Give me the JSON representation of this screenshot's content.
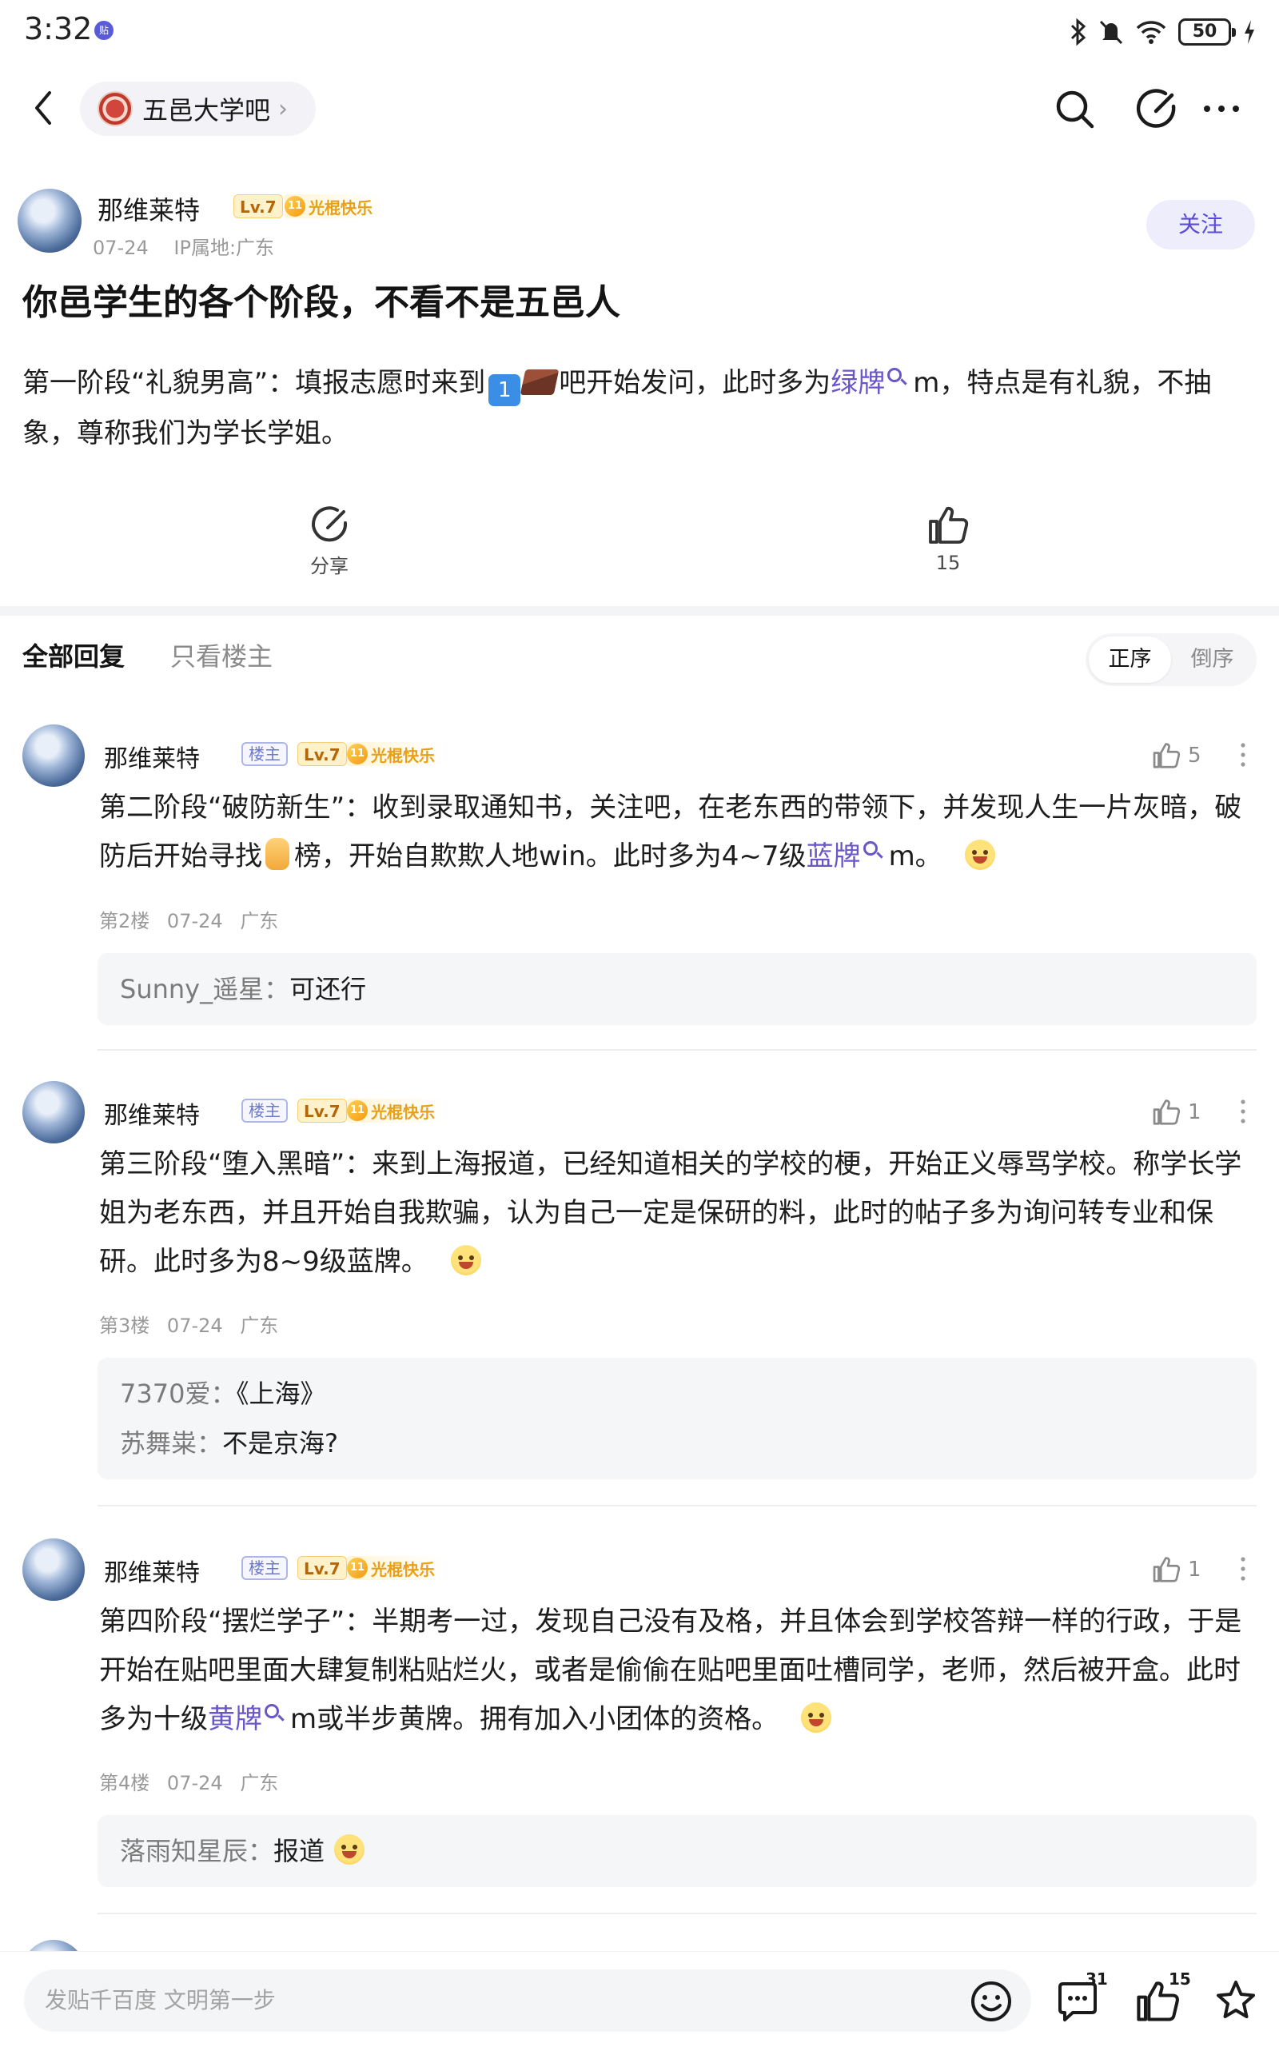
{
  "status_bar": {
    "time": "3:32",
    "battery": "50"
  },
  "nav": {
    "forum_name": "五邑大学吧"
  },
  "post": {
    "author": "那维莱特",
    "level": "Lv.7",
    "member_label": "光棍快乐",
    "member_badge_num": "11",
    "date": "07-24",
    "ip": "IP属地:广东",
    "follow_label": "关注",
    "title": "你邑学生的各个阶段，不看不是五邑人",
    "body_part1": "第一阶段“礼貌男高”：填报志愿时来到",
    "emoji_one": "1",
    "body_part2": "吧开始发问，此时多为",
    "body_link": "绿牌",
    "body_part3": "m，特点是有礼貌，不抽象，尊称我们为学长学姐。",
    "share_label": "分享",
    "like_count": "15"
  },
  "reply_tabs": {
    "all_label": "全部回复",
    "owner_only_label": "只看楼主",
    "sort_asc": "正序",
    "sort_desc": "倒序"
  },
  "replies": [
    {
      "author": "那维莱特",
      "owner_tag": "楼主",
      "level": "Lv.7",
      "member_label": "光棍快乐",
      "likes": "5",
      "text_part1": "第二阶段“破防新生”：收到录取通知书，关注吧，在老东西的带领下，并发现人生一片灰暗，破防后开始寻找",
      "text_part2": "榜，开始自欺欺人地win。此时多为4~7级",
      "text_link": "蓝牌",
      "text_part3": "m。",
      "floor": "第2楼",
      "date": "07-24",
      "location": "广东",
      "sub_replies": [
        {
          "user": "Sunny_遥星：",
          "text": "可还行"
        }
      ]
    },
    {
      "author": "那维莱特",
      "owner_tag": "楼主",
      "level": "Lv.7",
      "member_label": "光棍快乐",
      "likes": "1",
      "text": "第三阶段“堕入黑暗”：来到上海报道，已经知道相关的学校的梗，开始正义辱骂学校。称学长学姐为老东西，并且开始自我欺骗，认为自己一定是保研的料，此时的帖子多为询问转专业和保研。此时多为8~9级蓝牌。",
      "floor": "第3楼",
      "date": "07-24",
      "location": "广东",
      "sub_replies": [
        {
          "user": "7370爱：",
          "text": "《上海》"
        },
        {
          "user": "苏舞粜：",
          "text": "不是京海?"
        }
      ]
    },
    {
      "author": "那维莱特",
      "owner_tag": "楼主",
      "level": "Lv.7",
      "member_label": "光棍快乐",
      "likes": "1",
      "text_part1": "第四阶段“摆烂学子”：半期考一过，发现自己没有及格，并且体会到学校答辩一样的行政，于是开始在贴吧里面大肆复制粘贴烂火，或者是偷偷在贴吧里面吐槽同学，老师，然后被开盒。此时多为十级",
      "text_link": "黄牌",
      "text_part2": "m或半步黄牌。拥有加入小团体的资格。",
      "floor": "第4楼",
      "date": "07-24",
      "location": "广东",
      "sub_replies": [
        {
          "user": "落雨知星辰：",
          "text": "报道"
        }
      ]
    }
  ],
  "bottom_bar": {
    "input_placeholder": "发贴千百度 文明第一步",
    "comment_count": "31",
    "like_count": "15"
  },
  "colors": {
    "accent": "#5b4bd7",
    "link": "#6a55c9",
    "muted": "#9a9a9a"
  }
}
